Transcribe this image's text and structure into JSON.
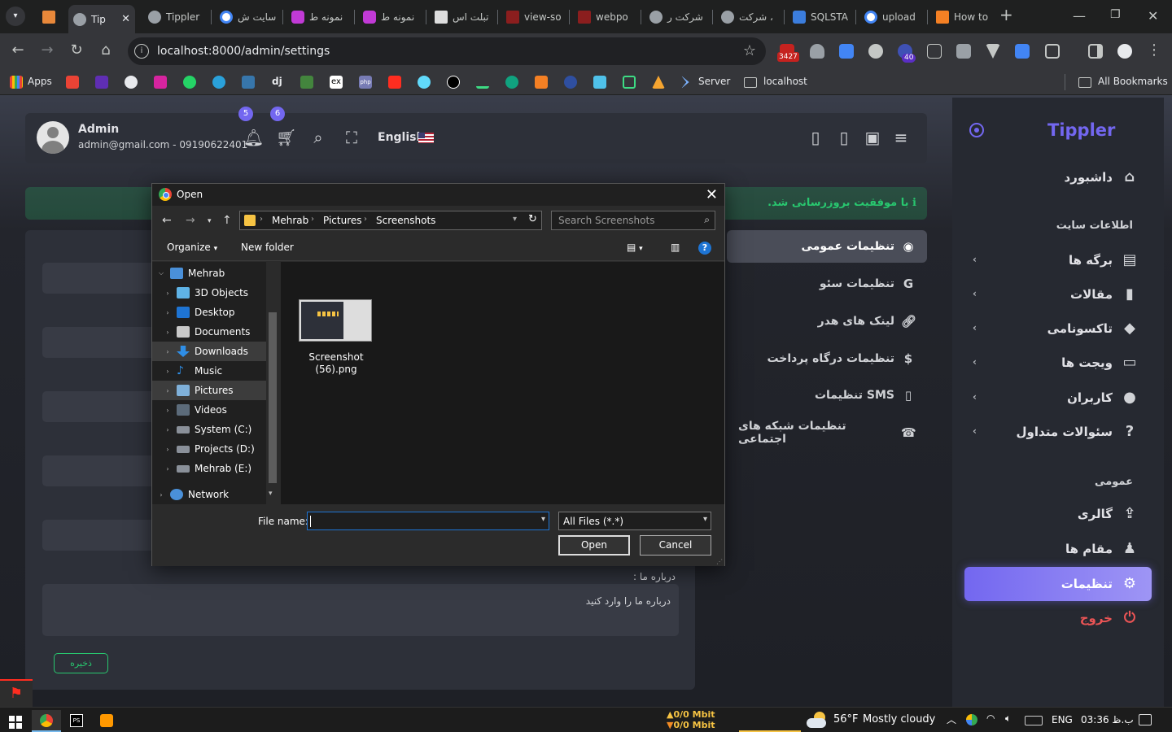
{
  "browser": {
    "tabs": [
      {
        "label": "Tip",
        "active": true
      },
      {
        "label": "Tippler"
      },
      {
        "label": "سایت ش"
      },
      {
        "label": "نمونه ط"
      },
      {
        "label": "نمونه ط"
      },
      {
        "label": "تبلت اس"
      },
      {
        "label": "view-so"
      },
      {
        "label": "webpo"
      },
      {
        "label": "شرکت ر"
      },
      {
        "label": "شرکت ،"
      },
      {
        "label": "SQLSTA"
      },
      {
        "label": "upload"
      },
      {
        "label": "How to"
      }
    ],
    "url": "localhost:8000/admin/settings",
    "ext_badge_1": "3427",
    "ext_badge_2": "40",
    "bookmarks": {
      "apps": "Apps",
      "server": "Server",
      "localhost": "localhost",
      "all_bookmarks": "All Bookmarks",
      "ex_label": "ex",
      "php_label": "php",
      "dj_label": "dj"
    }
  },
  "header": {
    "user_name": "Admin",
    "user_email": "admin@gmail.com - 09190622401",
    "notifications_count": "5",
    "cart_count": "6",
    "language": "English"
  },
  "alert": {
    "text": "با موفقیت بروزرسانی شد."
  },
  "sidebar": {
    "logo": "Tippler",
    "dashboard": "داشبورد",
    "section_site_info": "اطلاعات سایت",
    "items": [
      {
        "label": "برگه ها",
        "icon": "file-text-icon"
      },
      {
        "label": "مقالات",
        "icon": "file-icon"
      },
      {
        "label": "تاکسونامی",
        "icon": "tags-icon"
      },
      {
        "label": "ویجت ها",
        "icon": "hdd-icon"
      },
      {
        "label": "کاربران",
        "icon": "users-icon"
      },
      {
        "label": "سئوالات متداول",
        "icon": "question-circle-icon"
      }
    ],
    "section_general": "عمومی",
    "gallery": "گالری",
    "roles": "مقام ها",
    "settings": "تنظیمات",
    "logout": "خروج"
  },
  "settings_menu": {
    "items": [
      {
        "label": "تنظیمات عمومی",
        "icon": "globe-icon",
        "active": true
      },
      {
        "label": "تنظیمات سئو",
        "icon": "google-icon"
      },
      {
        "label": "لینک های هدر",
        "icon": "link-icon"
      },
      {
        "label": "تنظیمات درگاه پرداخت",
        "icon": "dollar-icon"
      },
      {
        "label": "تنظیمات SMS",
        "icon": "mobile-icon"
      },
      {
        "label": "تنظیمات شبکه های اجتماعی",
        "icon": "phone-square-icon"
      }
    ]
  },
  "form": {
    "about_label": "درباره ما :",
    "about_placeholder": "درباره ما را وارد کنید",
    "save_label": "ذخیره"
  },
  "dialog": {
    "title": "Open",
    "breadcrumb": [
      "Mehrab",
      "Pictures",
      "Screenshots"
    ],
    "search_placeholder": "Search Screenshots",
    "organize": "Organize",
    "new_folder": "New folder",
    "help": "?",
    "tree": [
      {
        "label": "Mehrab",
        "level": 0,
        "expanded": true
      },
      {
        "label": "3D Objects",
        "level": 1
      },
      {
        "label": "Desktop",
        "level": 1
      },
      {
        "label": "Documents",
        "level": 1
      },
      {
        "label": "Downloads",
        "level": 1,
        "selected": true
      },
      {
        "label": "Music",
        "level": 1
      },
      {
        "label": "Pictures",
        "level": 1,
        "selected": true
      },
      {
        "label": "Videos",
        "level": 1
      },
      {
        "label": "System (C:)",
        "level": 1
      },
      {
        "label": "Projects (D:)",
        "level": 1
      },
      {
        "label": "Mehrab (E:)",
        "level": 1
      },
      {
        "label": "Network",
        "level": 0
      }
    ],
    "file": {
      "name": "Screenshot (56).png"
    },
    "file_name_label": "File name:",
    "file_name_value": "",
    "file_type": "All Files (*.*)",
    "open_button": "Open",
    "cancel_button": "Cancel"
  },
  "taskbar": {
    "net_up": "0/0 Mbit",
    "net_down": "0/0 Mbit",
    "weather_temp": "56°F",
    "weather_text": "Mostly cloudy",
    "language": "ENG",
    "time": "03:36 ب.ظ"
  }
}
